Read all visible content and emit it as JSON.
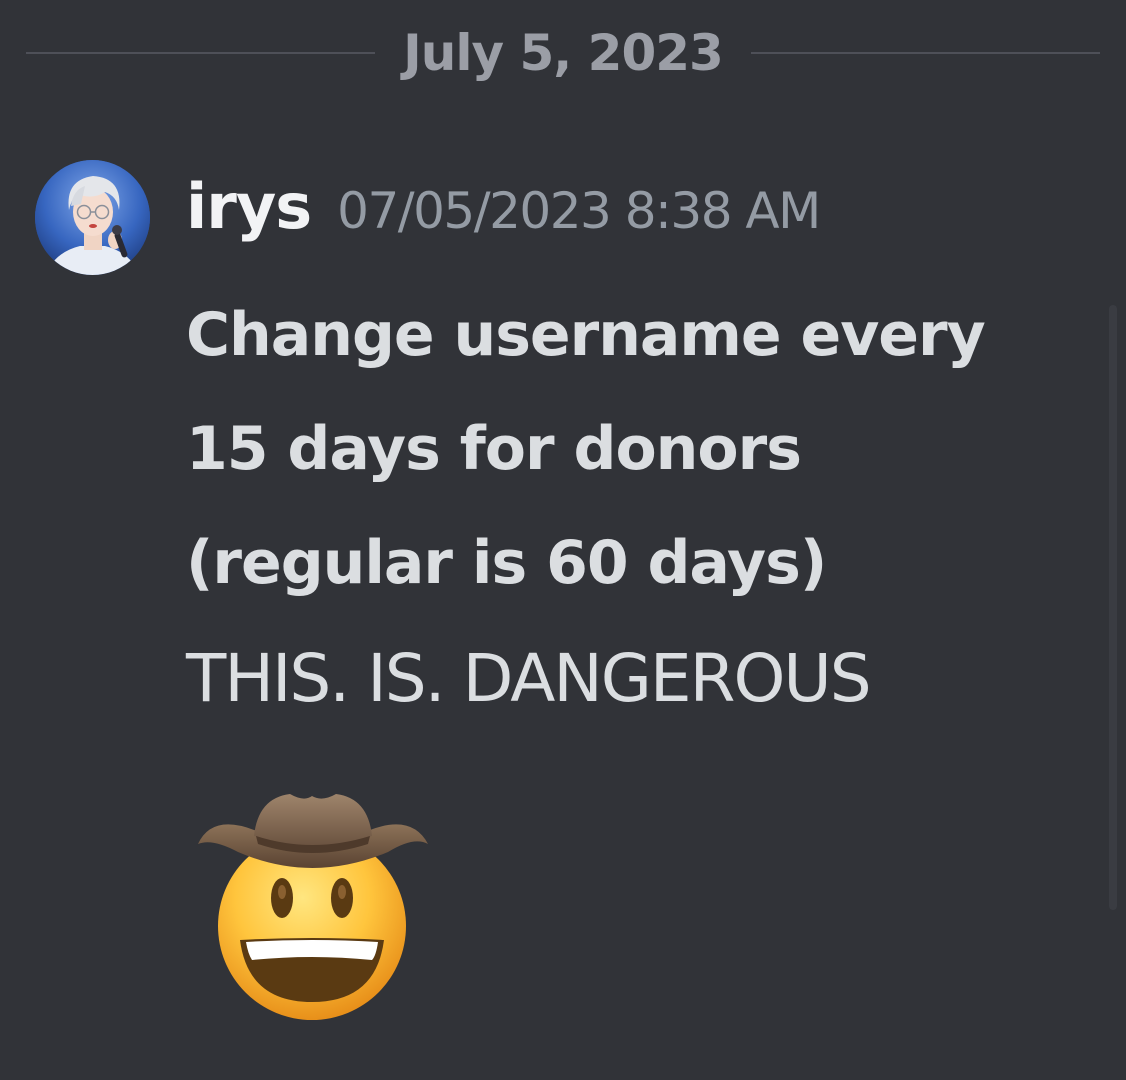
{
  "divider": {
    "date": "July 5, 2023"
  },
  "message": {
    "username": "irys",
    "timestamp": "07/05/2023 8:38 AM",
    "bold_lines": [
      "Change username every",
      "15 days for donors",
      "(regular is 60 days)"
    ],
    "plain_text": "THIS. IS. DANGEROUS",
    "emoji": "cowboy-hat-face-emoji",
    "avatar": "user-avatar-photo"
  },
  "colors": {
    "background": "#313338",
    "divider_line": "#4e5058",
    "muted_text": "#949ba4",
    "username": "#f2f3f5",
    "body_text": "#dbdee1"
  }
}
